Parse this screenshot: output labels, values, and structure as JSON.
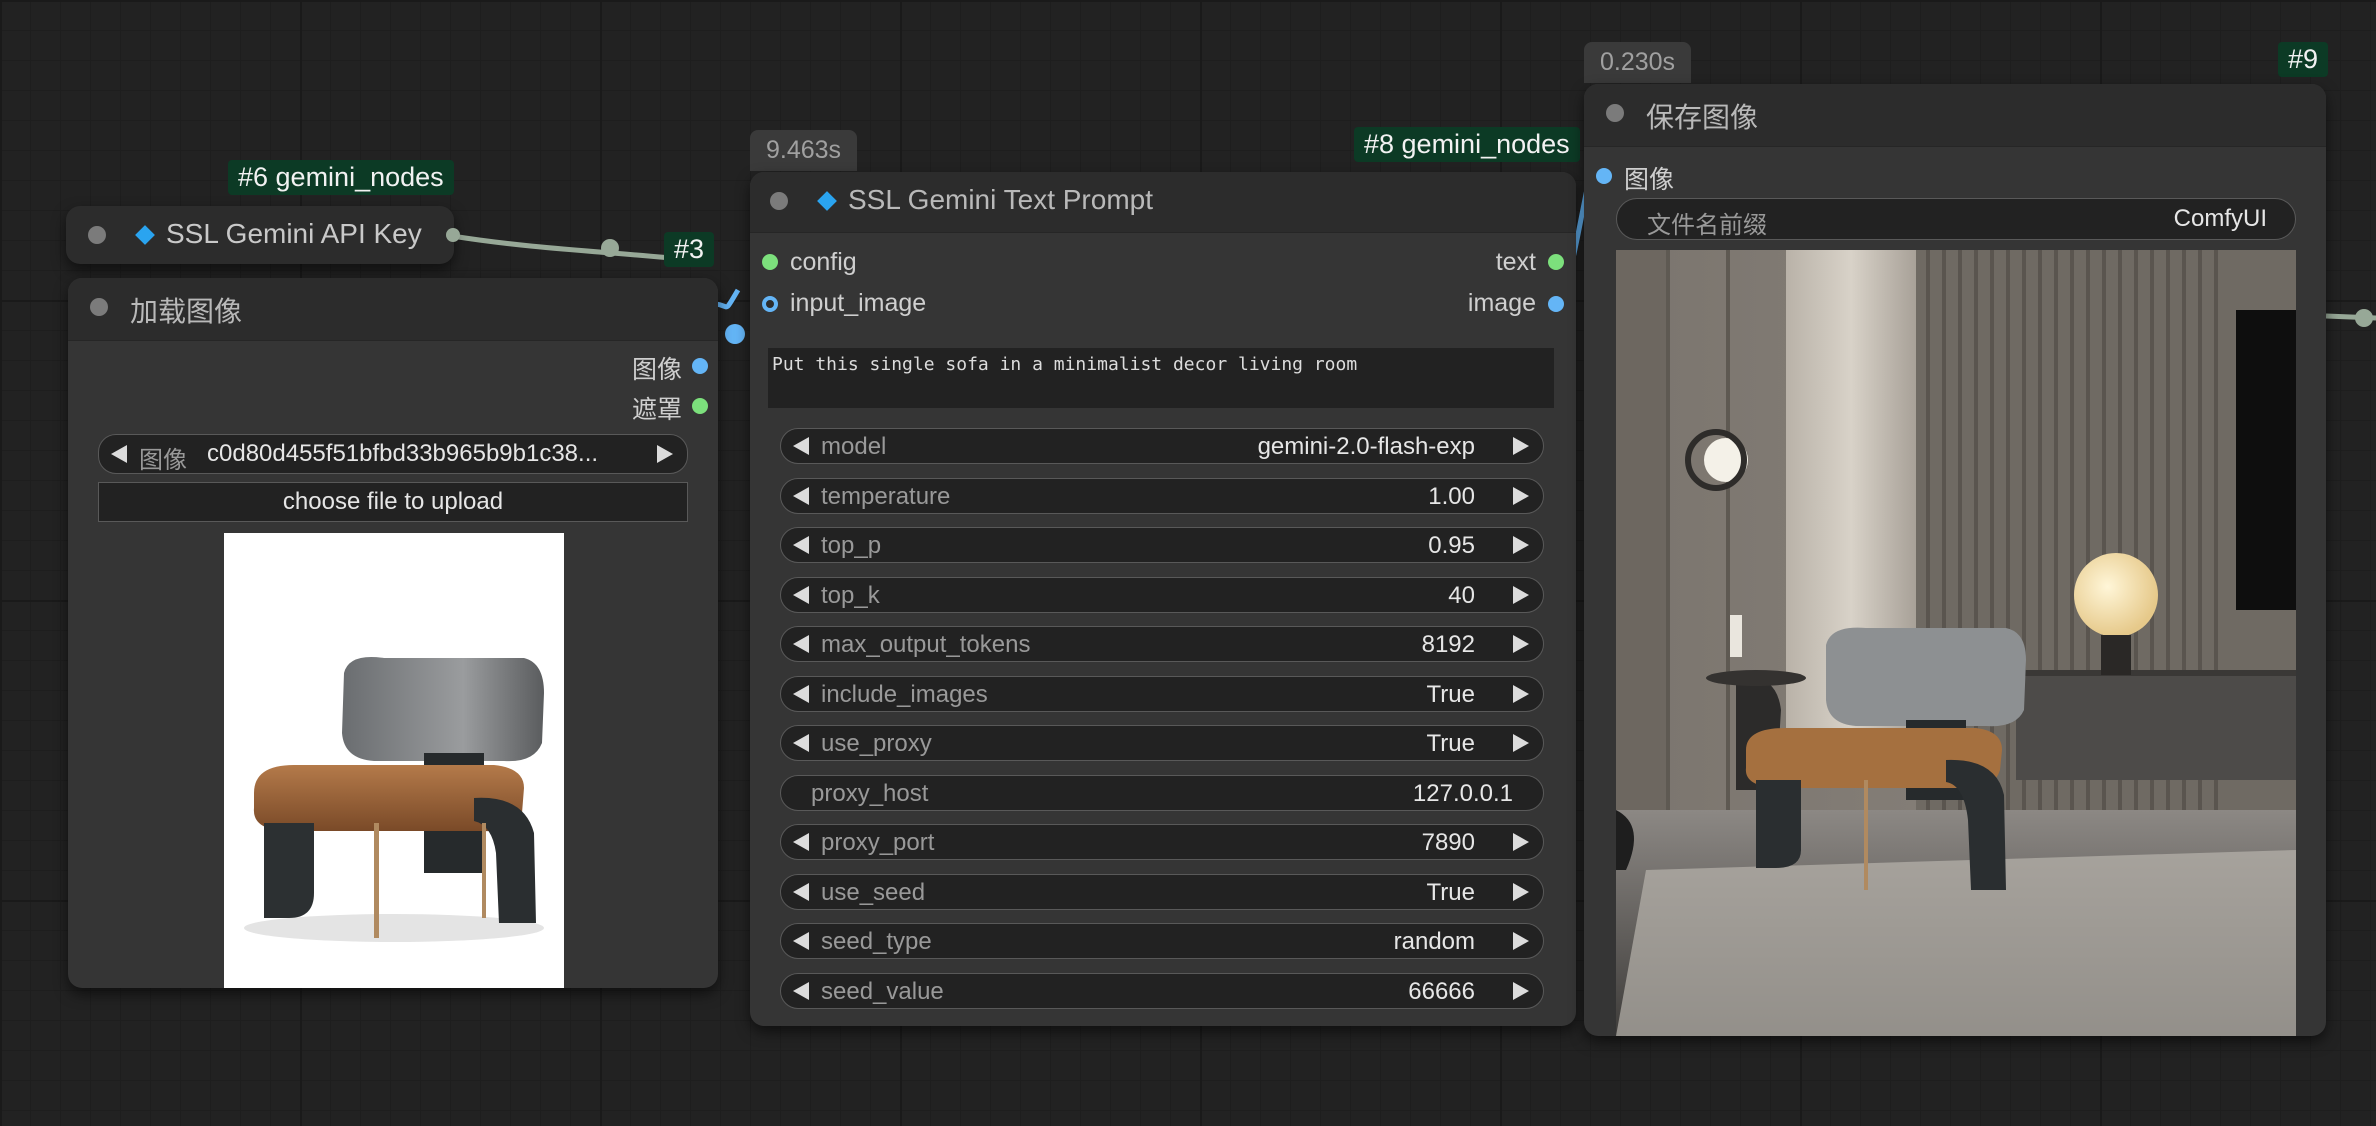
{
  "api_key_node": {
    "badge": "#6 gemini_nodes",
    "title": "SSL Gemini API Key"
  },
  "reroute_badge": "#3",
  "load_image_node": {
    "title": "加载图像",
    "outputs": [
      "图像",
      "遮罩"
    ],
    "image_widget": {
      "label": "图像",
      "value": "c0d80d455f51bfbd33b965b9b1c38..."
    },
    "upload_label": "choose file to upload"
  },
  "text_prompt_node": {
    "badge": "#8 gemini_nodes",
    "time": "9.463s",
    "title": "SSL Gemini Text Prompt",
    "inputs": [
      "config",
      "input_image"
    ],
    "outputs": [
      "text",
      "image"
    ],
    "prompt": "Put this single sofa in a minimalist decor living room",
    "widgets": [
      {
        "label": "model",
        "value": "gemini-2.0-flash-exp",
        "arrows": true
      },
      {
        "label": "temperature",
        "value": "1.00",
        "arrows": true
      },
      {
        "label": "top_p",
        "value": "0.95",
        "arrows": true
      },
      {
        "label": "top_k",
        "value": "40",
        "arrows": true
      },
      {
        "label": "max_output_tokens",
        "value": "8192",
        "arrows": true
      },
      {
        "label": "include_images",
        "value": "True",
        "arrows": true
      },
      {
        "label": "use_proxy",
        "value": "True",
        "arrows": true
      },
      {
        "label": "proxy_host",
        "value": "127.0.0.1",
        "arrows": false
      },
      {
        "label": "proxy_port",
        "value": "7890",
        "arrows": true
      },
      {
        "label": "use_seed",
        "value": "True",
        "arrows": true
      },
      {
        "label": "seed_type",
        "value": "random",
        "arrows": true
      },
      {
        "label": "seed_value",
        "value": "66666",
        "arrows": true
      }
    ]
  },
  "save_image_node": {
    "badge": "#9",
    "time": "0.230s",
    "title": "保存图像",
    "input": "图像",
    "prefix_label": "文件名前缀",
    "prefix_value": "ComfyUI"
  },
  "colors": {
    "canvas": "#222222",
    "node": "#353535",
    "badge": "#0c3a25",
    "image_slot": "#64b5f6",
    "mask_slot": "#7ce07c",
    "accent": "#2aa4f0"
  }
}
